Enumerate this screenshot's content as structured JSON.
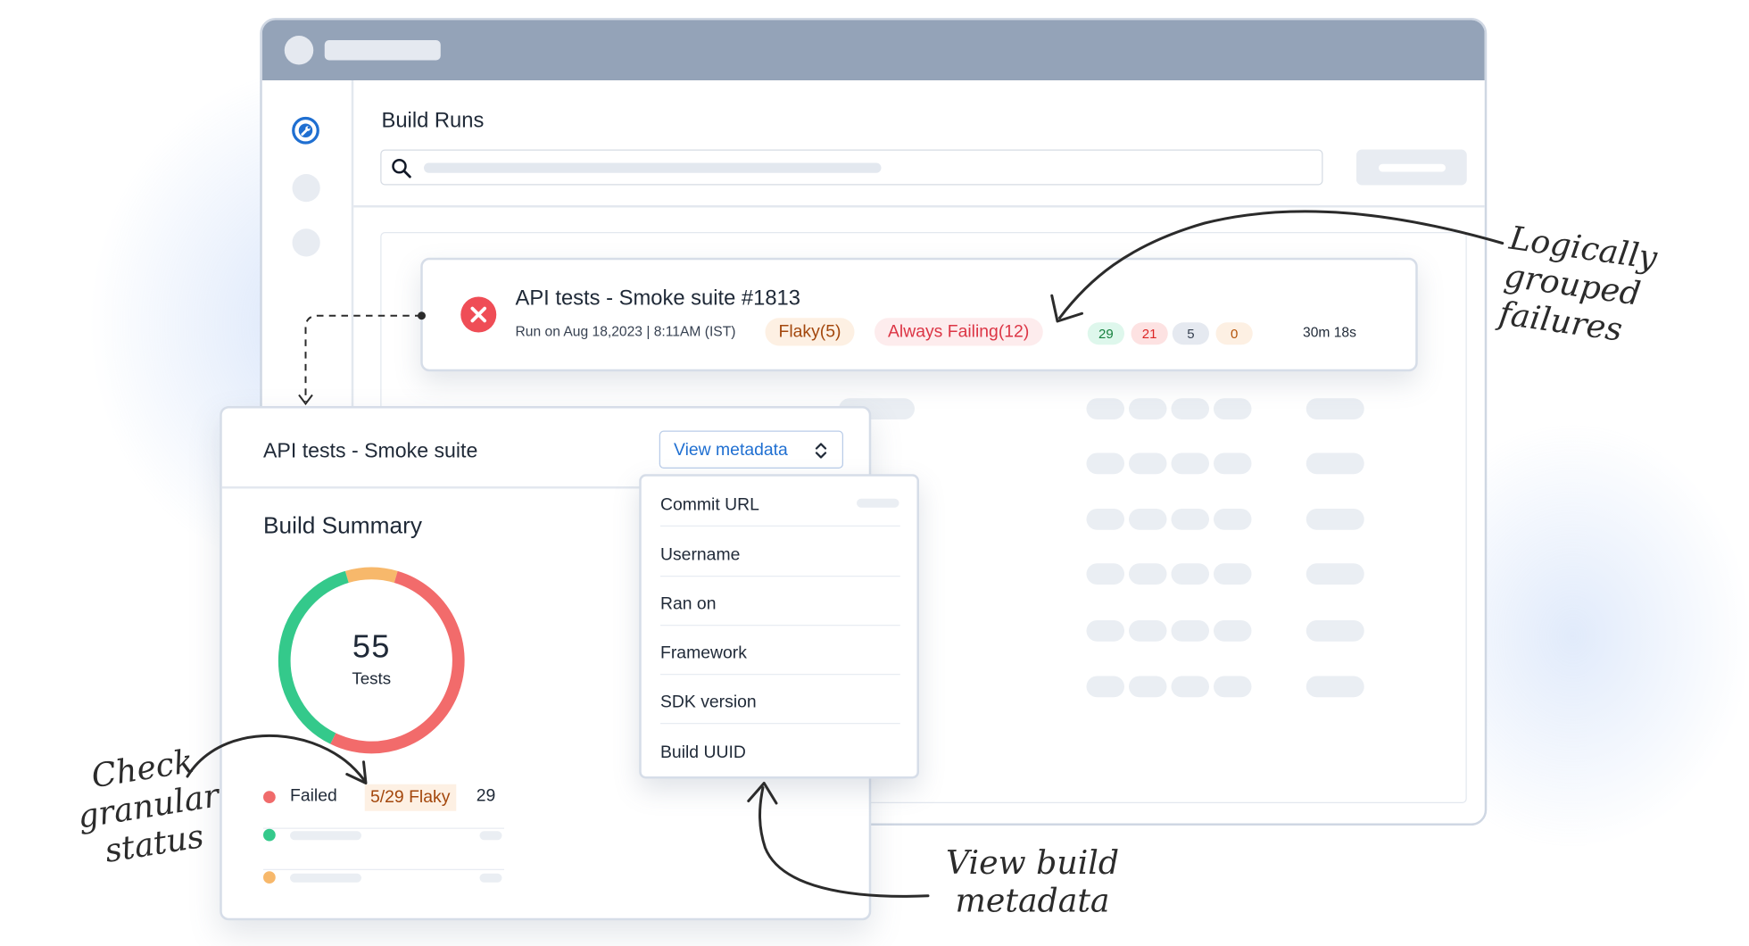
{
  "page": {
    "title": "Build Runs"
  },
  "run": {
    "title": "API tests - Smoke suite #1813",
    "meta": "Run on Aug 18,2023 | 8:11AM (IST)",
    "flaky_tag": "Flaky(5)",
    "failing_tag": "Always Failing(12)",
    "counts": [
      "29",
      "21",
      "5",
      "0"
    ],
    "duration": "30m 18s"
  },
  "panel": {
    "title": "API tests - Smoke suite",
    "metadata_button": "View metadata",
    "summary_title": "Build Summary",
    "total": "55",
    "total_label": "Tests",
    "segments": {
      "failed": 29,
      "passed": 21,
      "flaky": 5
    },
    "legend": {
      "failed_label": "Failed",
      "flaky_label": "5/29 Flaky",
      "failed_count": "29"
    }
  },
  "metadata_menu": [
    "Commit URL",
    "Username",
    "Ran on",
    "Framework",
    "SDK version",
    "Build UUID"
  ],
  "annotations": {
    "grouped_failures": [
      "Logically",
      "grouped",
      "failures"
    ],
    "granular_status": [
      "Check",
      "granular",
      "status"
    ],
    "build_metadata": [
      "View build",
      "metadata"
    ]
  },
  "colors": {
    "failed": "#f26b6b",
    "passed": "#34c98b",
    "flaky": "#f7b86b",
    "accent": "#1f6fd1"
  },
  "icons": [
    "wrench-icon",
    "search-icon",
    "error-icon",
    "chevron-updown-icon"
  ]
}
